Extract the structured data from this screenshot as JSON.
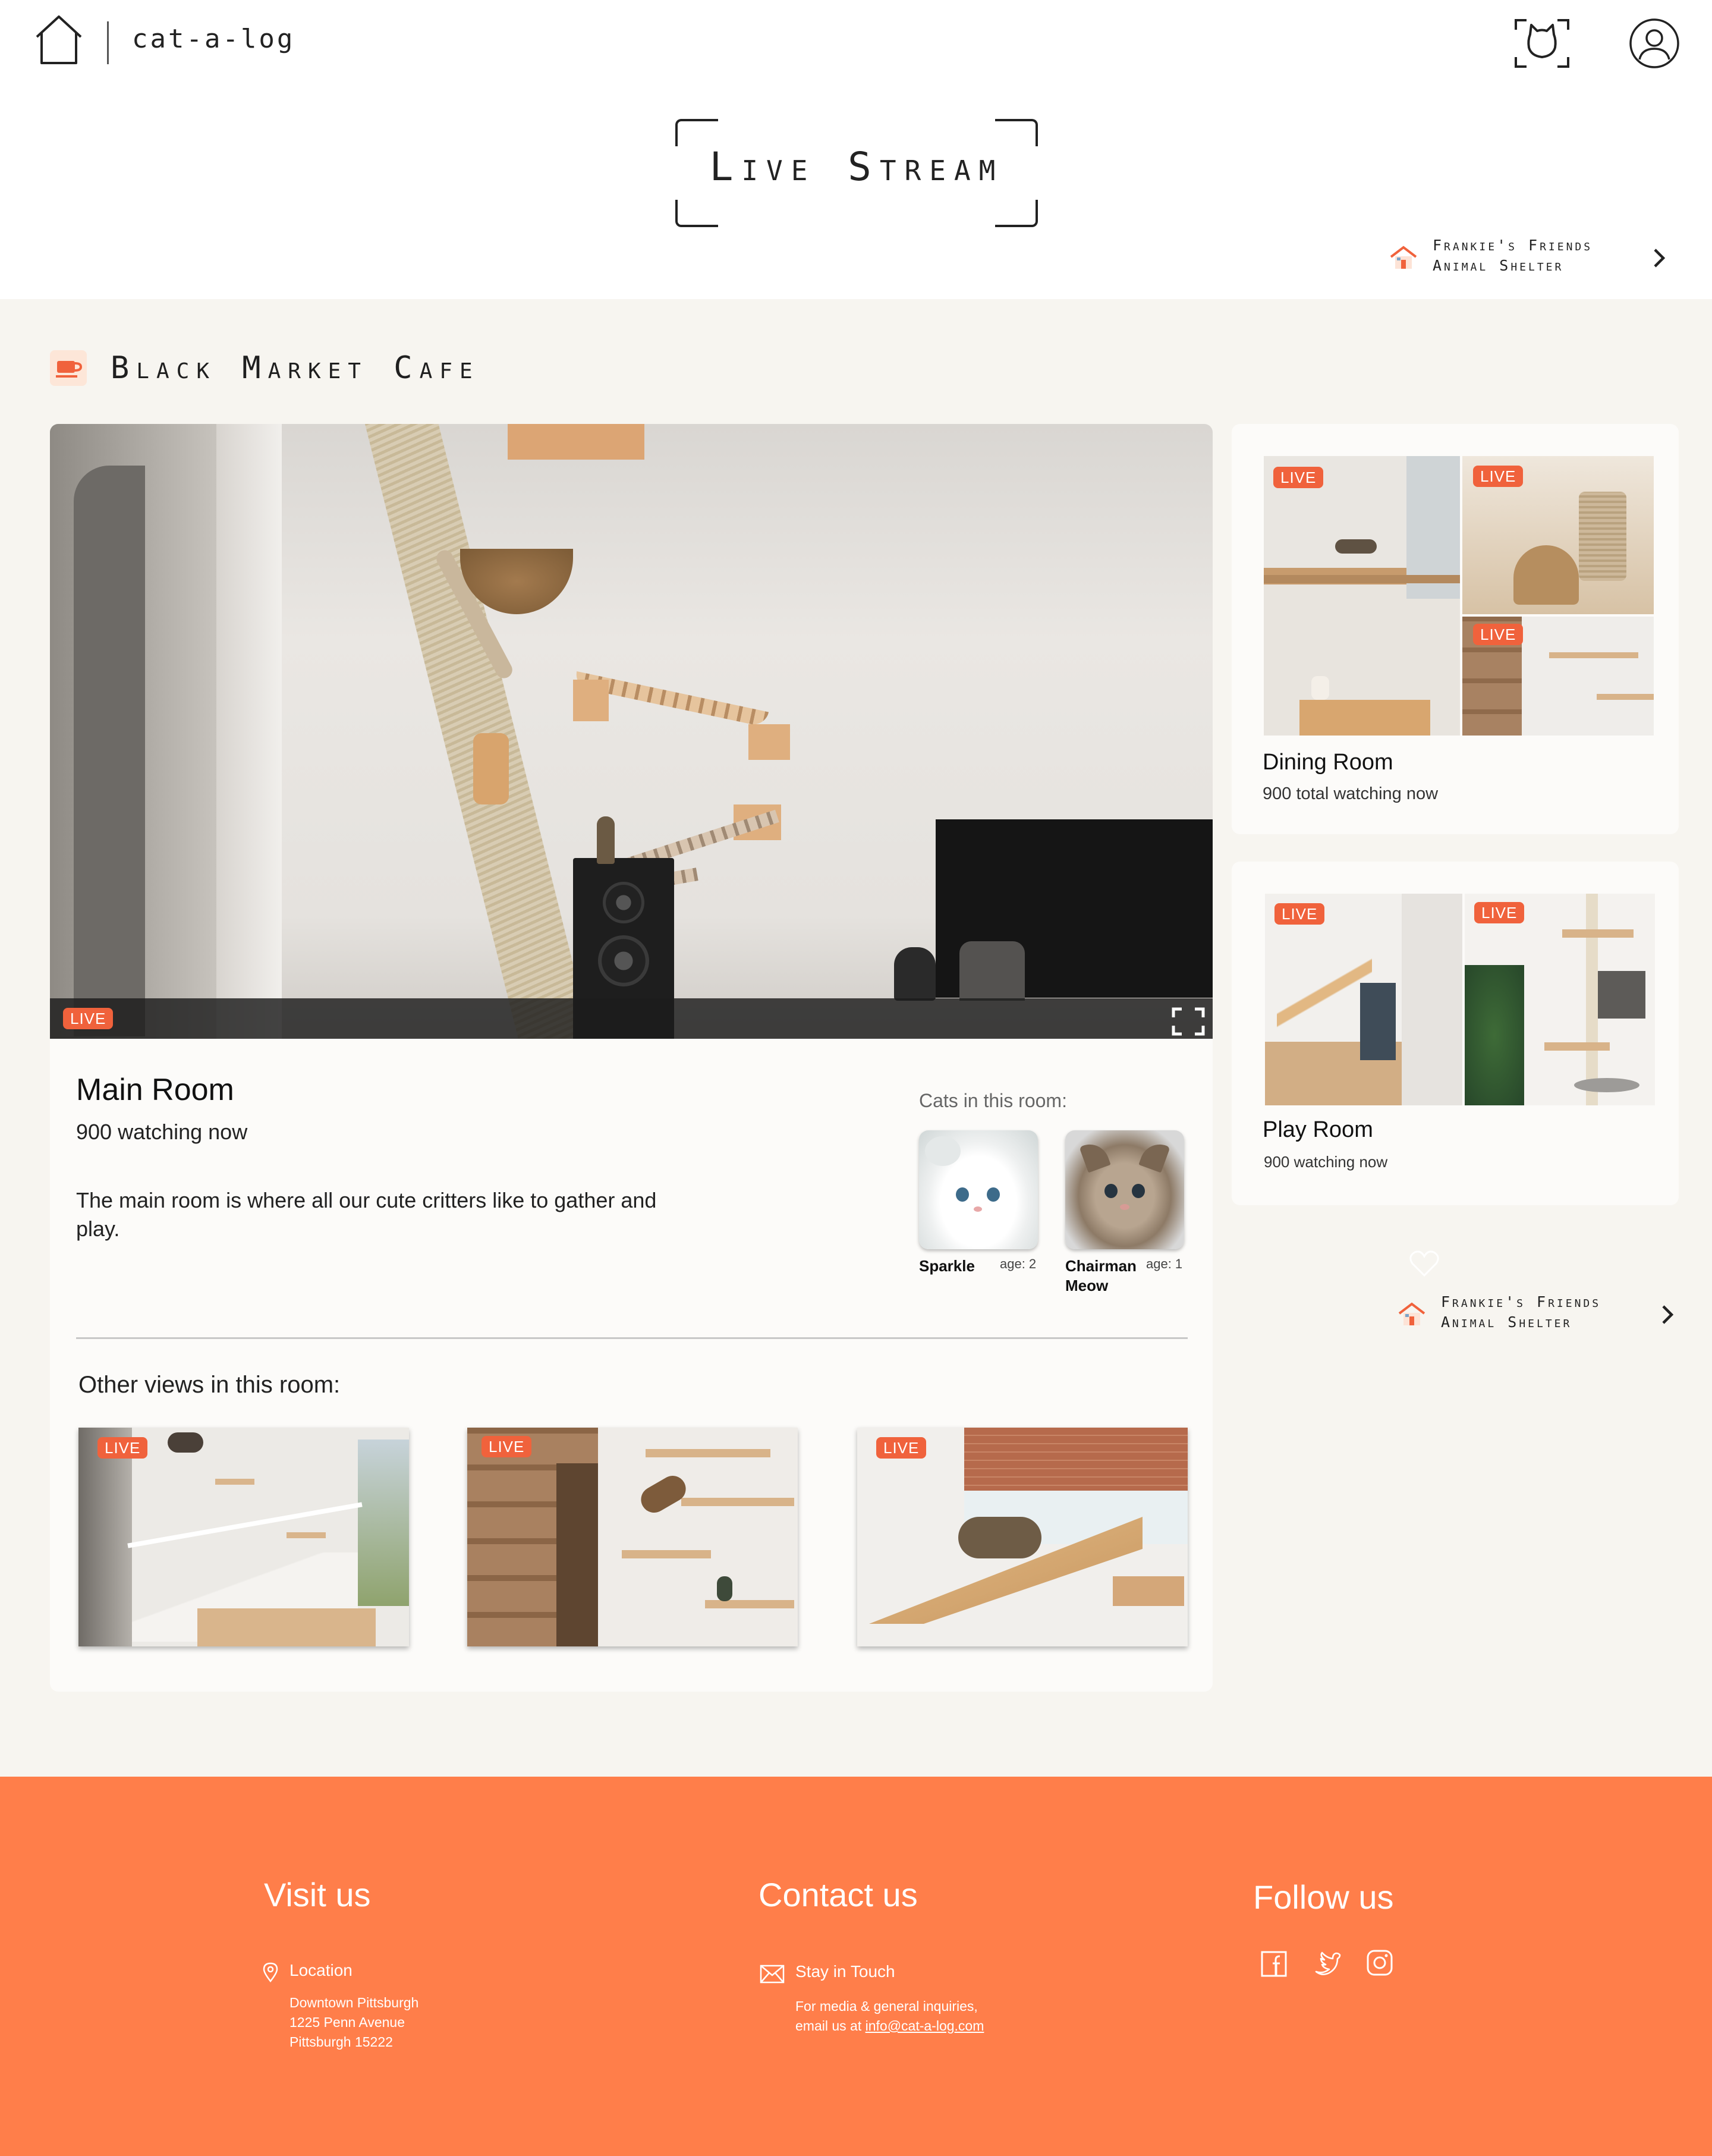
{
  "header": {
    "brand": "cat-a-log",
    "page_title": "Live Stream"
  },
  "shelter": {
    "line1": "Frankie's Friends",
    "line2": "Animal Shelter"
  },
  "cafe": {
    "name": "Black Market Cafe"
  },
  "main_room": {
    "live_label": "LIVE",
    "title": "Main Room",
    "watching": "900 watching now",
    "description": "The main room is where all our cute critters like to gather and play.",
    "cats_label": "Cats in this room:",
    "cats": [
      {
        "name": "Sparkle",
        "age": "age: 2"
      },
      {
        "name": "Chairman Meow",
        "age": "age: 1"
      }
    ],
    "other_views_label": "Other views in this room:",
    "other_views": [
      {
        "live_label": "LIVE"
      },
      {
        "live_label": "LIVE"
      },
      {
        "live_label": "LIVE"
      }
    ]
  },
  "side_rooms": [
    {
      "title": "Dining Room",
      "watching": "900 total watching now",
      "live_label": "LIVE"
    },
    {
      "title": "Play Room",
      "watching": "900 watching now",
      "live_label": "LIVE"
    }
  ],
  "footer": {
    "visit": {
      "heading": "Visit us",
      "sub": "Location",
      "line1": "Downtown Pittsburgh",
      "line2": "1225 Penn Avenue",
      "line3": "Pittsburgh 15222"
    },
    "contact": {
      "heading": "Contact us",
      "sub": "Stay in Touch",
      "line1": "For media & general inquiries,",
      "line2_prefix": "email us at ",
      "email": "info@cat-a-log.com"
    },
    "follow": {
      "heading": "Follow us",
      "icons": [
        "facebook-icon",
        "twitter-icon",
        "instagram-icon"
      ]
    }
  },
  "colors": {
    "accent": "#ff7e4a",
    "live_badge": "#f0623c",
    "page_bg": "#f7f5f0",
    "card_bg": "#fcfbf9"
  }
}
